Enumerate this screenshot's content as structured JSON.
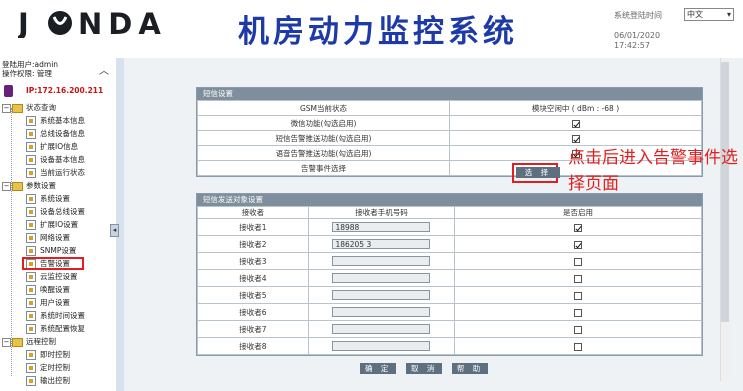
{
  "header": {
    "logo_text": "JONDA",
    "title": "机房动力监控系统",
    "login_time_label": "系统登陆时间",
    "language": "中文",
    "date": "06/01/2020",
    "time": "17:42:57"
  },
  "sidebar": {
    "user": "登陆用户:admin",
    "permission": "操作权限: 管理",
    "ip": "IP:172.16.200.211",
    "groups": [
      {
        "label": "状态查询",
        "items": [
          "系统基本信息",
          "总线设备信息",
          "扩展IO信息",
          "设备基本信息",
          "当前运行状态"
        ]
      },
      {
        "label": "参数设置",
        "items": [
          "系统设置",
          "设备总线设置",
          "扩展IO设置",
          "网络设置",
          "SNMP设置",
          "告警设置",
          "云监控设置",
          "唤醒设置",
          "用户设置",
          "系统时间设置",
          "系统配置恢复"
        ]
      },
      {
        "label": "远程控制",
        "items": [
          "即时控制",
          "定时控制",
          "输出控制"
        ]
      }
    ]
  },
  "sms_settings": {
    "header": "短信设置",
    "gsm_label": "GSM当前状态",
    "gsm_value": "模块空闲中 ( dBm : -68 )",
    "rows": [
      {
        "label": "微信功能(勾选启用)",
        "checked": true
      },
      {
        "label": "短信告警推送功能(勾选启用)",
        "checked": true
      },
      {
        "label": "语音告警推送功能(勾选启用)",
        "checked": true
      }
    ],
    "event_label": "告警事件选择",
    "select_button": "选 择"
  },
  "recipients": {
    "header": "短信发送对象设置",
    "col_recipient": "接收者",
    "col_phone": "接收者手机号码",
    "col_enabled": "是否启用",
    "rows": [
      {
        "name": "接收者1",
        "phone": "18988",
        "enabled": true
      },
      {
        "name": "接收者2",
        "phone": "186205        3",
        "enabled": true
      },
      {
        "name": "接收者3",
        "phone": "",
        "enabled": false
      },
      {
        "name": "接收者4",
        "phone": "",
        "enabled": false
      },
      {
        "name": "接收者5",
        "phone": "",
        "enabled": false
      },
      {
        "name": "接收者6",
        "phone": "",
        "enabled": false
      },
      {
        "name": "接收者7",
        "phone": "",
        "enabled": false
      },
      {
        "name": "接收者8",
        "phone": "",
        "enabled": false
      }
    ]
  },
  "buttons": {
    "ok": "确 定",
    "cancel": "取 消",
    "help": "帮 助"
  },
  "annotation": "点击后进入告警事件选择页面",
  "colors": {
    "title": "#1e3aa8",
    "highlight": "#e02020",
    "panel_header": "#7e8e9d"
  }
}
